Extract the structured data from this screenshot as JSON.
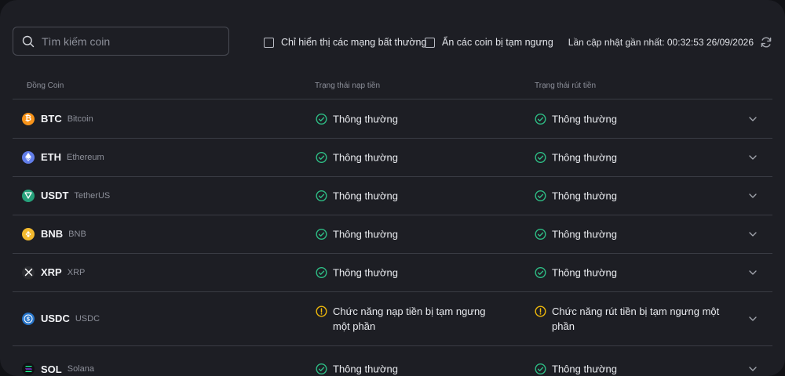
{
  "search": {
    "placeholder": "Tìm kiếm coin"
  },
  "filters": {
    "abnormal_label": "Chỉ hiển thị các mạng bất thường",
    "suspended_label": "Ẩn các coin bị tạm ngưng"
  },
  "last_updated": "Lần cập nhật gần nhất: 00:32:53 26/09/2026",
  "table": {
    "headers": {
      "coin": "Đồng Coin",
      "deposit": "Trạng thái nạp tiền",
      "withdraw": "Trạng thái rút tiền"
    },
    "rows": [
      {
        "symbol": "BTC",
        "name": "Bitcoin",
        "deposit": "Thông thường",
        "withdraw": "Thông thường",
        "deposit_status": "ok",
        "withdraw_status": "ok",
        "icon": "bitcoin-icon",
        "color": "#f7931a"
      },
      {
        "symbol": "ETH",
        "name": "Ethereum",
        "deposit": "Thông thường",
        "withdraw": "Thông thường",
        "deposit_status": "ok",
        "withdraw_status": "ok",
        "icon": "ethereum-icon",
        "color": "#627eea"
      },
      {
        "symbol": "USDT",
        "name": "TetherUS",
        "deposit": "Thông thường",
        "withdraw": "Thông thường",
        "deposit_status": "ok",
        "withdraw_status": "ok",
        "icon": "tether-icon",
        "color": "#26a17b"
      },
      {
        "symbol": "BNB",
        "name": "BNB",
        "deposit": "Thông thường",
        "withdraw": "Thông thường",
        "deposit_status": "ok",
        "withdraw_status": "ok",
        "icon": "bnb-icon",
        "color": "#f3ba2f"
      },
      {
        "symbol": "XRP",
        "name": "XRP",
        "deposit": "Thông thường",
        "withdraw": "Thông thường",
        "deposit_status": "ok",
        "withdraw_status": "ok",
        "icon": "xrp-icon",
        "color": "#2b2c31"
      },
      {
        "symbol": "USDC",
        "name": "USDC",
        "deposit": "Chức năng nạp tiền bị tạm ngưng một phần",
        "withdraw": "Chức năng rút tiền bị tạm ngưng một phần",
        "deposit_status": "warning",
        "withdraw_status": "warning",
        "icon": "usdc-icon",
        "color": "#2775ca"
      },
      {
        "symbol": "SOL",
        "name": "Solana",
        "deposit": "Thông thường",
        "withdraw": "Thông thường",
        "deposit_status": "ok",
        "withdraw_status": "ok",
        "icon": "solana-icon",
        "color": "#111114"
      }
    ]
  },
  "colors": {
    "ok": "#2ebd85",
    "warning": "#f0b90b"
  }
}
